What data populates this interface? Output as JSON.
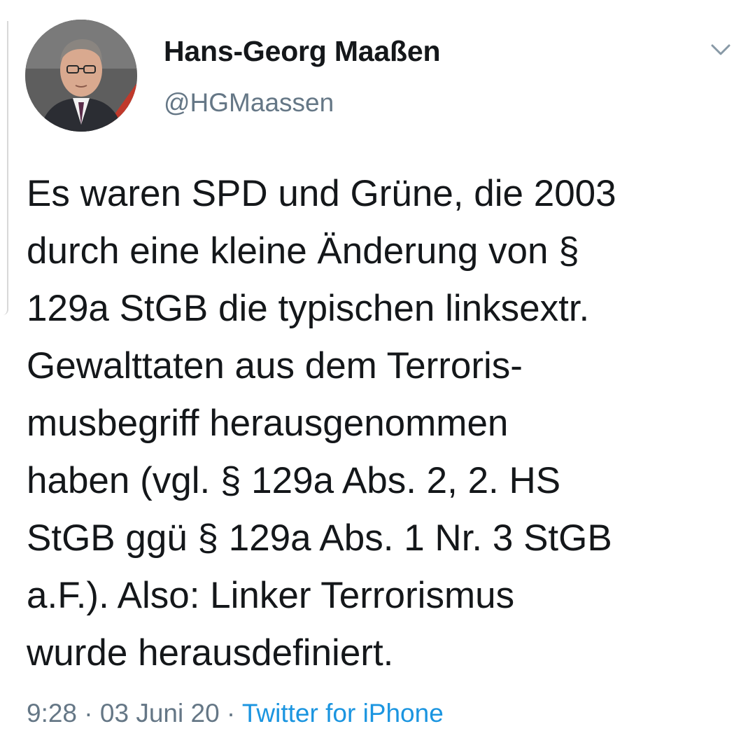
{
  "author": {
    "display_name": "Hans-Georg Maaßen",
    "handle": "@HGMaassen",
    "avatar_icon": "profile-photo"
  },
  "menu": {
    "icon": "chevron-down-icon"
  },
  "tweet": {
    "lines": [
      "Es waren SPD und Grüne, die 2003",
      "durch eine kleine Änderung von §",
      "129a StGB die typischen linksextr.",
      "Gewalttaten aus dem Terroris-",
      "musbegriff herausgenommen",
      "haben (vgl. § 129a Abs. 2, 2. HS",
      "StGB ggü § 129a Abs. 1 Nr. 3 StGB",
      "a.F.). Also: Linker Terrorismus",
      "wurde herausdefiniert."
    ]
  },
  "meta": {
    "time": "9:28",
    "separator": " · ",
    "date": "03 Juni 20",
    "source": "Twitter for iPhone"
  },
  "colors": {
    "text": "#14171a",
    "secondary": "#657786",
    "link": "#1b95e0"
  }
}
